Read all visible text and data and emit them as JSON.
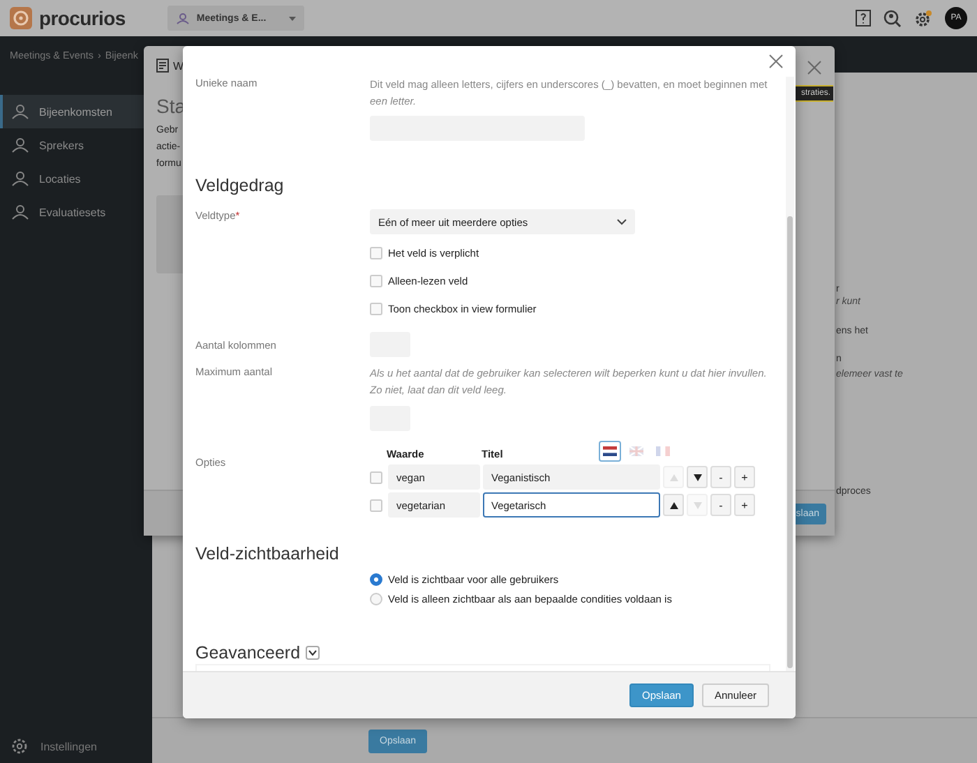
{
  "top_bar": {
    "logo": "procurios",
    "module_switcher": "Meetings & E...",
    "avatar": "PA"
  },
  "breadcrumb": {
    "items": [
      "Meetings & Events",
      "Bijeenk"
    ],
    "separator": "›"
  },
  "sidebar": {
    "items": [
      {
        "label": "Bijeenkomsten",
        "selected": true
      },
      {
        "label": "Sprekers",
        "selected": false
      },
      {
        "label": "Locaties",
        "selected": false
      },
      {
        "label": "Evaluatiesets",
        "selected": false
      }
    ],
    "footer_item": "Instellingen"
  },
  "background_dialog": {
    "title": "W",
    "heading": "Sta",
    "text_lines": [
      "Gebr",
      "actie-",
      "formu"
    ],
    "tooltip": "straties."
  },
  "background_page": {
    "fragments": [
      {
        "text": "r",
        "italic": false
      },
      {
        "text": "r kunt",
        "italic": true
      },
      {
        "text": "ens het",
        "italic": false
      },
      {
        "text": "n",
        "italic": false
      },
      {
        "text": "elemeer vast te",
        "italic": true
      },
      {
        "text": "dproces",
        "italic": false
      }
    ],
    "side_button": "slaan",
    "save_button": "Opslaan"
  },
  "modal": {
    "unique_name": {
      "label": "Unieke naam",
      "hint": "Dit veld mag alleen letters, cijfers en underscores (_) bevatten, en moet beginnen met",
      "hint_end": "een letter."
    },
    "sections": [
      {
        "title": "Veldgedrag"
      }
    ],
    "field_type": {
      "label": "Veldtype",
      "required_mark": "*",
      "value": "Eén of meer uit meerdere opties"
    },
    "checkboxes": [
      {
        "label": "Het veld is verplicht",
        "checked": false
      },
      {
        "label": "Alleen-lezen veld",
        "checked": false
      },
      {
        "label": "Toon checkbox in view formulier",
        "checked": false
      }
    ],
    "columns": {
      "label": "Aantal kolommen"
    },
    "maximum": {
      "label": "Maximum aantal",
      "hint": "Als u het aantal dat de gebruiker kan selecteren wilt beperken kunt u dat hier invullen. Zo niet, laat dan dit veld leeg."
    },
    "options": {
      "label": "Opties",
      "columns": [
        "Waarde",
        "Titel"
      ],
      "languages": [
        {
          "kind": "nl",
          "selected": true
        },
        {
          "kind": "en",
          "selected": false
        },
        {
          "kind": "fr",
          "selected": false
        }
      ],
      "rows": [
        {
          "checked": false,
          "value": "vegan",
          "title": "Veganistisch",
          "focused": false,
          "up_disabled": true,
          "down_disabled": false
        },
        {
          "checked": false,
          "value": "vegetarian",
          "title": "Vegetarisch",
          "focused": true,
          "up_disabled": false,
          "down_disabled": true
        }
      ],
      "remove": "-",
      "add": "+"
    },
    "visibility": {
      "title": "Veld-zichtbaarheid",
      "radios": [
        {
          "label": "Veld is zichtbaar voor alle gebruikers",
          "selected": true
        },
        {
          "label": "Veld is alleen zichtbaar als aan bepaalde condities voldaan is",
          "selected": false
        }
      ]
    },
    "advanced": {
      "title": "Geavanceerd",
      "expanded": false
    },
    "buttons": [
      {
        "label": "Opslaan",
        "kind": "primary"
      },
      {
        "label": "Annuleer",
        "kind": "secondary"
      }
    ]
  }
}
